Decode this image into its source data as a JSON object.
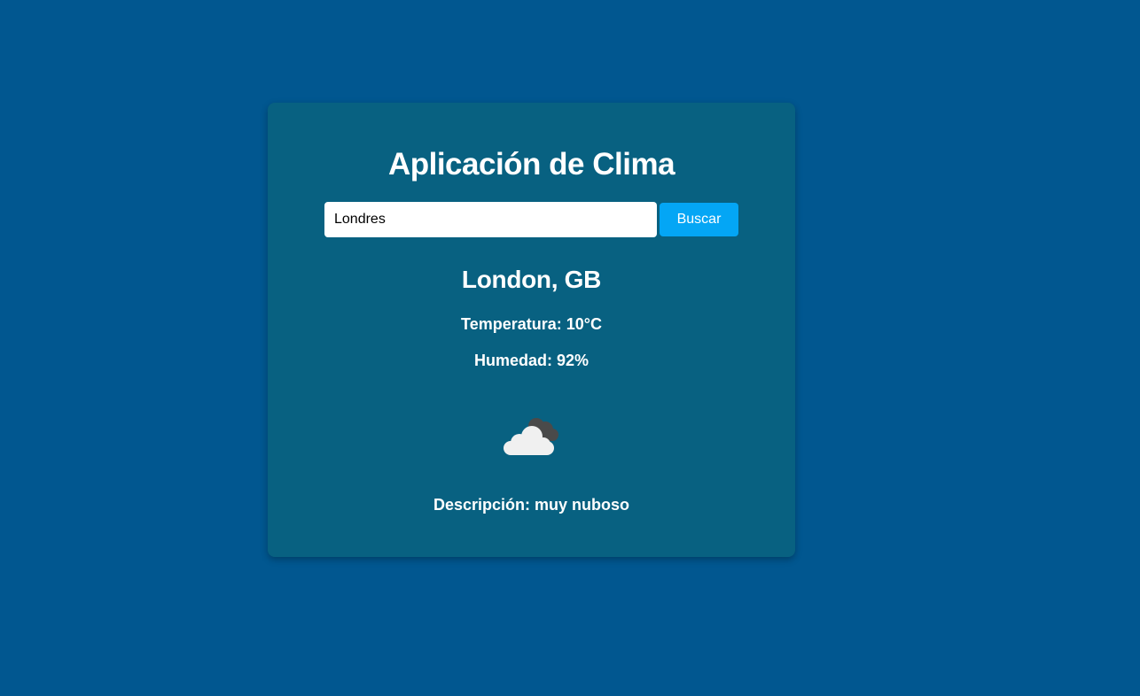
{
  "app": {
    "title": "Aplicación de Clima"
  },
  "search": {
    "value": "Londres",
    "button_label": "Buscar"
  },
  "weather": {
    "location": "London, GB",
    "temperature_text": "Temperatura: 10°C",
    "humidity_text": "Humedad: 92%",
    "description_text": "Descripción: muy nuboso",
    "icon": "broken-clouds-icon"
  },
  "colors": {
    "background": "#015790",
    "card": "#086181",
    "button": "#04a6f5",
    "text": "#ffffff"
  }
}
